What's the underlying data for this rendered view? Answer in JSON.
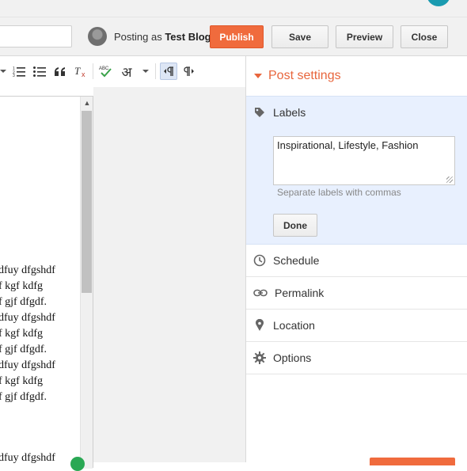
{
  "header": {
    "posting_prefix": "Posting as",
    "blog_name": "Test Blog",
    "buttons": {
      "publish": "Publish",
      "save": "Save",
      "preview": "Preview",
      "close": "Close"
    }
  },
  "toolbar": {
    "items": [
      "numbered-list-icon",
      "bullet-list-icon",
      "quote-icon",
      "remove-format-icon",
      "spellcheck-icon",
      "input-tools-icon",
      "ltr-icon",
      "rtl-icon"
    ],
    "input_tools_glyph": "अ",
    "spellcheck_glyph": "ABC"
  },
  "editor": {
    "lines": [
      "dfuy  dfgshdf",
      "f kgf kdfg",
      "f gjf dfgdf.",
      "dfuy  dfgshdf",
      "f kgf kdfg",
      "f gjf dfgdf.",
      "dfuy  dfgshdf",
      "f kgf kdfg",
      "f gjf dfgdf."
    ],
    "tail_line": "dfuy  dfgshdf"
  },
  "post_settings": {
    "title": "Post settings",
    "labels": {
      "heading": "Labels",
      "value": "Inspirational, Lifestyle, Fashion",
      "hint": "Separate labels with commas",
      "done": "Done"
    },
    "sections": [
      {
        "label": "Schedule",
        "icon": "clock-icon"
      },
      {
        "label": "Permalink",
        "icon": "link-icon"
      },
      {
        "label": "Location",
        "icon": "pin-icon"
      },
      {
        "label": "Options",
        "icon": "gear-icon"
      }
    ]
  },
  "colors": {
    "accent": "#e8663d",
    "publish": "#f06b3d",
    "labels_bg": "#e8f0fe"
  }
}
